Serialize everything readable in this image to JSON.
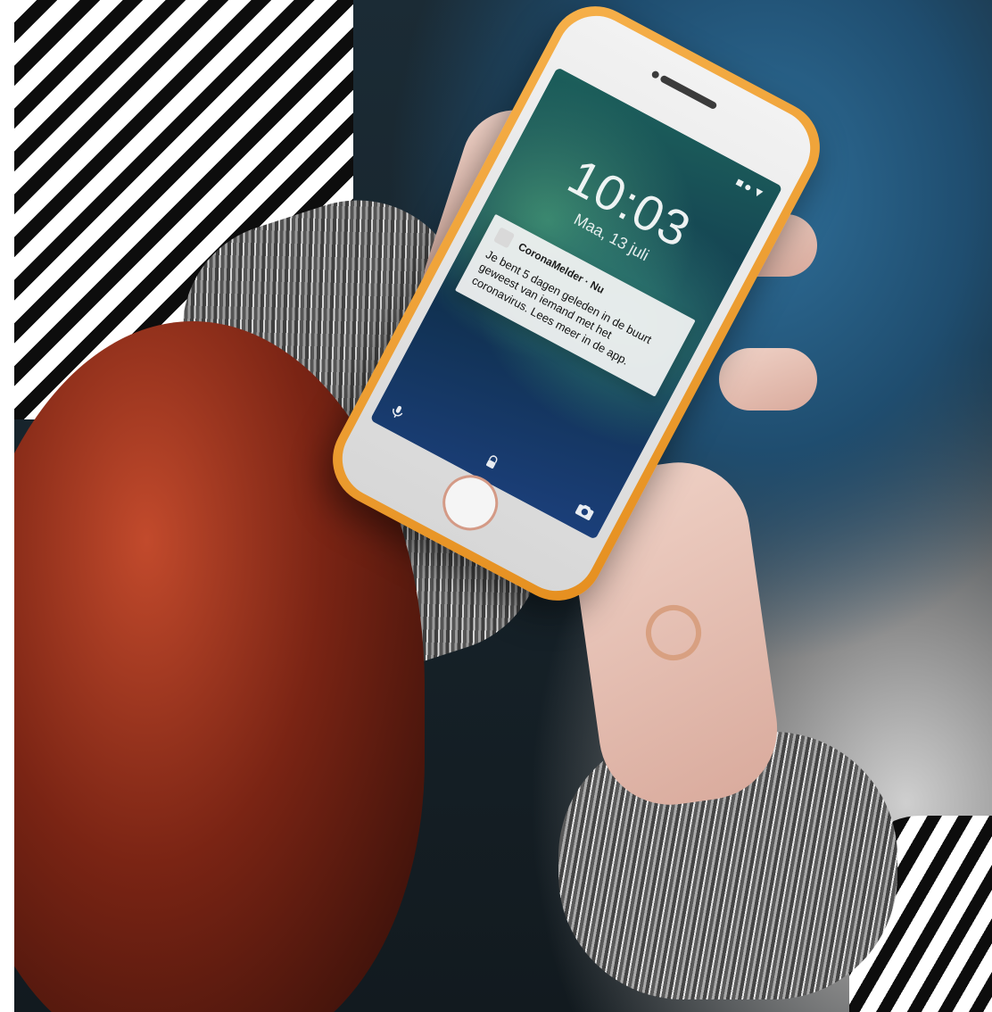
{
  "phone": {
    "status_icons": "■●▼",
    "lockscreen": {
      "time": "10:03",
      "date": "Maa, 13 juli"
    },
    "notification": {
      "app_name": "CoronaMelder · Nu",
      "message": "Je bent 5 dagen geleden in de buurt geweest van iemand met het coronavirus. Lees meer in de app."
    },
    "icons": {
      "left": "mic-icon",
      "center": "lock-icon",
      "right": "camera-icon"
    }
  },
  "colors": {
    "case_orange": "#E58F1F",
    "notification_bg": "#F5F5F5"
  }
}
